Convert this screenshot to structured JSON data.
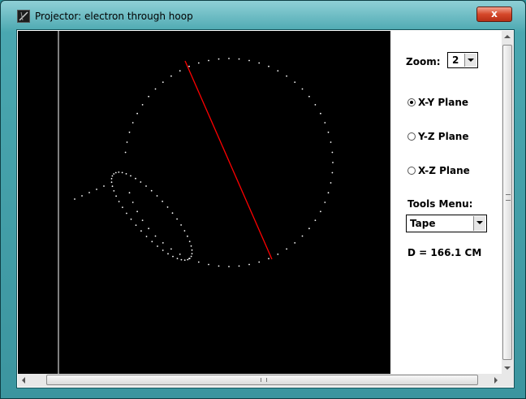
{
  "window": {
    "title": "Projector: electron through hoop",
    "close_glyph": "x"
  },
  "panel": {
    "zoom_label": "Zoom:",
    "zoom_value": "2",
    "planes": [
      {
        "label": "X-Y Plane",
        "selected": true
      },
      {
        "label": "Y-Z Plane",
        "selected": false
      },
      {
        "label": "X-Z Plane",
        "selected": false
      }
    ],
    "tools_label": "Tools Menu:",
    "tools_value": "Tape",
    "measurement": "D = 166.1 CM"
  },
  "canvas": {
    "background": "#000000",
    "axis_color": "#ffffff",
    "dot_color": "#ffffff",
    "tape_color": "#ff0000"
  },
  "icons": {
    "app": "projector-icon",
    "dropdown": "chevron-down-icon",
    "radio": "radio-button-icon"
  }
}
